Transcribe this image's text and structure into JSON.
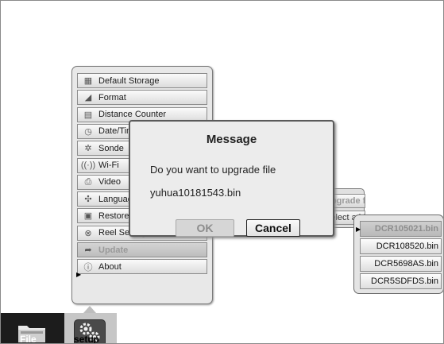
{
  "menu": {
    "items": [
      {
        "label": "Default Storage",
        "icon": "storage-icon",
        "glyph": "▦"
      },
      {
        "label": "Format",
        "icon": "eraser-icon",
        "glyph": "◢"
      },
      {
        "label": "Distance Counter",
        "icon": "counter-icon",
        "glyph": "▤"
      },
      {
        "label": "Date/Time",
        "icon": "clock-icon",
        "glyph": "◷"
      },
      {
        "label": "Sonde",
        "icon": "sonde-icon",
        "glyph": "✲"
      },
      {
        "label": "Wi-Fi",
        "icon": "wifi-icon",
        "glyph": "((·))"
      },
      {
        "label": "Video",
        "icon": "video-icon",
        "glyph": "⎙"
      },
      {
        "label": "Language",
        "icon": "language-icon",
        "glyph": "✣"
      },
      {
        "label": "Restore",
        "icon": "restore-icon",
        "glyph": "▣"
      },
      {
        "label": "Reel Settings",
        "icon": "reel-icon",
        "glyph": "⊗"
      },
      {
        "label": "Update",
        "icon": "update-icon",
        "glyph": "➦"
      },
      {
        "label": "About",
        "icon": "info-icon",
        "glyph": "ⓘ"
      }
    ],
    "selected_index": 10
  },
  "submenu": {
    "items": [
      "Upgrade from file",
      "Select a bin file"
    ]
  },
  "file_list": {
    "files": [
      "DCR105021.bin",
      "DCR108520.bin",
      "DCR5698AS.bin",
      "DCR5SDFDS.bin"
    ],
    "selected_index": 0
  },
  "dialog": {
    "title": "Message",
    "line1": "Do you want to upgrade file",
    "line2": "yuhua10181543.bin",
    "ok_label": "OK",
    "cancel_label": "Cancel"
  },
  "taskbar": {
    "file_label": "File",
    "setup_label": "setup"
  }
}
